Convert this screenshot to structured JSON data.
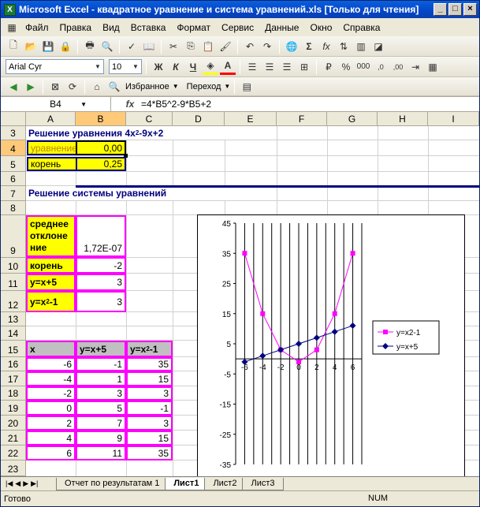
{
  "window": {
    "title": "Microsoft Excel - квадратное уравнение и система уравнений.xls  [Только для чтения]",
    "min": "_",
    "max": "□",
    "close": "×"
  },
  "menu": [
    "Файл",
    "Правка",
    "Вид",
    "Вставка",
    "Формат",
    "Сервис",
    "Данные",
    "Окно",
    "Справка"
  ],
  "toolbar": {
    "font": "Arial Cyr",
    "size": "10",
    "bold": "Ж",
    "italic": "К",
    "underline": "Ч",
    "percent": "%",
    "thousands": "000",
    "favorites": "Избранное",
    "goto": "Переход"
  },
  "formula_bar": {
    "name_box": "B4",
    "fx": "fx",
    "formula": "=4*B5^2-9*B5+2"
  },
  "columns": [
    "A",
    "B",
    "C",
    "D",
    "E",
    "F",
    "G",
    "H",
    "I"
  ],
  "rows": [
    "3",
    "4",
    "5",
    "6",
    "7",
    "8",
    "9",
    "10",
    "11",
    "12",
    "13",
    "14",
    "15",
    "16",
    "17",
    "18",
    "19",
    "20",
    "21",
    "22",
    "23"
  ],
  "sheet": {
    "title1": "Решение уравнения 4x",
    "title1_sup": "2",
    "title1_rest": "-9x+2",
    "a4": "уравнение",
    "b4": "0,00",
    "a5": "корень",
    "b5": "0,25",
    "title2": "Решение системы уравнений",
    "a9": "среднее отклоне ние",
    "b9": "1,72E-07",
    "a10": "корень",
    "b10": "-2",
    "a11": "y=x+5",
    "b11": "3",
    "a12": "y=x",
    "a12_sup": "2",
    "a12_rest": "-1",
    "b12": "3",
    "h15": [
      "x",
      "y=x+5",
      "y=x"
    ],
    "h15_sup": "2",
    "h15_rest": "-1",
    "table": [
      [
        "-6",
        "-1",
        "35"
      ],
      [
        "-4",
        "1",
        "15"
      ],
      [
        "-2",
        "3",
        "3"
      ],
      [
        "0",
        "5",
        "-1"
      ],
      [
        "2",
        "7",
        "3"
      ],
      [
        "4",
        "9",
        "15"
      ],
      [
        "6",
        "11",
        "35"
      ]
    ]
  },
  "chart_data": {
    "type": "line",
    "x": [
      -6,
      -4,
      -2,
      0,
      2,
      4,
      6
    ],
    "series": [
      {
        "name": "y=x2-1",
        "values": [
          35,
          15,
          3,
          -1,
          3,
          15,
          35
        ],
        "color": "#ff00ff"
      },
      {
        "name": "y=x+5",
        "values": [
          -1,
          1,
          3,
          5,
          7,
          9,
          11
        ],
        "color": "#000080"
      }
    ],
    "yticks": [
      "45",
      "35",
      "25",
      "15",
      "5",
      "-5",
      "-15",
      "-25",
      "-35"
    ],
    "xticks": [
      "-6",
      "-4",
      "-2",
      "0",
      "2",
      "4",
      "6"
    ],
    "ylim": [
      -35,
      45
    ],
    "xlim": [
      -7,
      7
    ],
    "grid": true,
    "legend": "right"
  },
  "tabs": {
    "items": [
      "Отчет по результатам 1",
      "Лист1",
      "Лист2",
      "Лист3"
    ],
    "active": 1
  },
  "status": {
    "ready": "Готово",
    "num": "NUM"
  }
}
